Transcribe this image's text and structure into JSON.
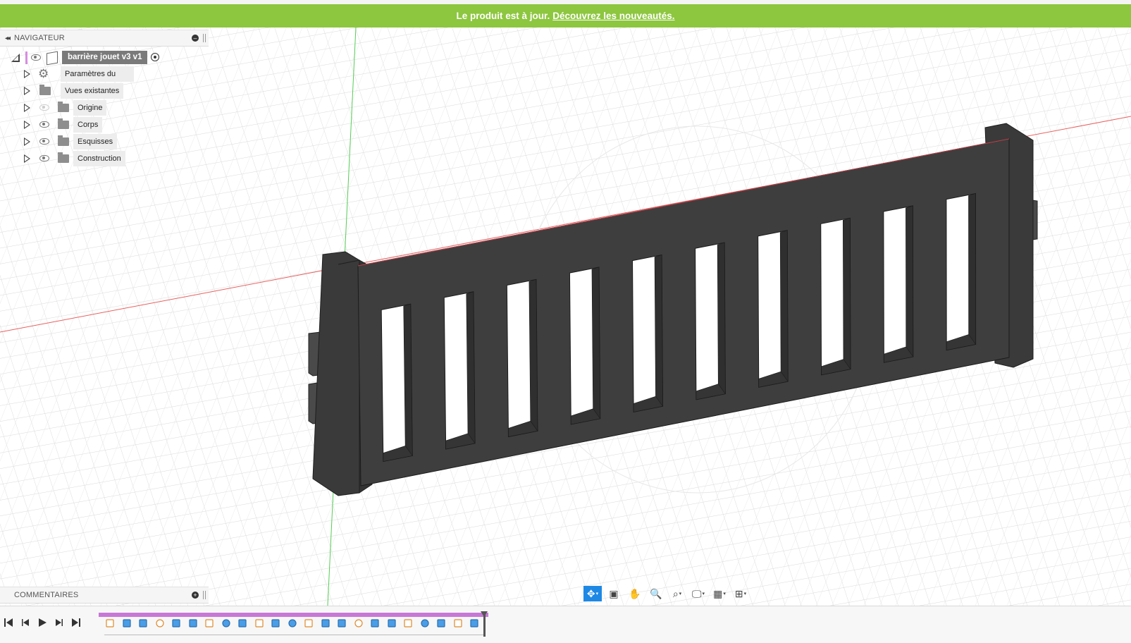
{
  "banner": {
    "text": "Le produit est à jour.",
    "link": "Découvrez les nouveautés."
  },
  "navigator": {
    "title": "NAVIGATEUR",
    "root_label": "barrière jouet v3 v1",
    "items": [
      {
        "label": "Paramètres du document",
        "icon": "gear-icon",
        "visible": null
      },
      {
        "label": "Vues existantes",
        "icon": "folder-icon",
        "visible": null
      },
      {
        "label": "Origine",
        "icon": "folder-icon",
        "visible": false
      },
      {
        "label": "Corps",
        "icon": "folder-icon",
        "visible": true
      },
      {
        "label": "Esquisses",
        "icon": "folder-icon",
        "visible": true
      },
      {
        "label": "Construction",
        "icon": "folder-icon",
        "visible": true
      }
    ]
  },
  "comments": {
    "title": "COMMENTAIRES"
  },
  "viewport": {
    "model": "toy gate with 10 rectangular openings",
    "grid_color": "#dcdcdc",
    "x_axis_color": "#e04040",
    "y_axis_color": "#40c040"
  },
  "toolbar": {
    "icons": [
      "orbit-icon",
      "look-at-icon",
      "pan-icon",
      "zoom-icon",
      "fit-icon",
      "display-settings-icon",
      "grid-settings-icon",
      "viewports-icon"
    ]
  },
  "timeline": {
    "controls": [
      "first-step-icon",
      "previous-step-icon",
      "play-icon",
      "next-step-icon",
      "last-step-icon"
    ],
    "feature_count": 23
  },
  "colors": {
    "banner": "#8dc63f",
    "model": "#3d3d3d",
    "timeline": "#c778d6",
    "active_tool": "#1e88e5"
  }
}
